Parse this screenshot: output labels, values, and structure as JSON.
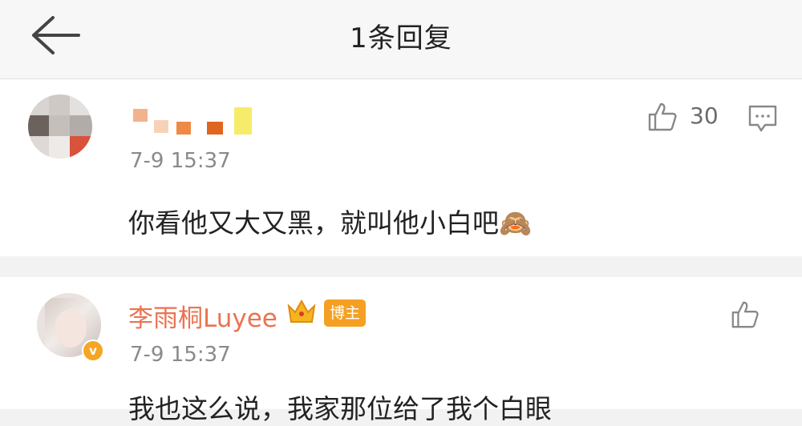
{
  "header": {
    "title": "1条回复",
    "back_icon": "arrow-left-icon"
  },
  "comment": {
    "timestamp": "7-9 15:37",
    "likes": "30",
    "text": "你看他又大又黑，就叫他小白吧",
    "emoji": "🙈",
    "icons": {
      "like": "thumbs-up-icon",
      "reply": "comment-icon"
    }
  },
  "reply": {
    "username": "李雨桐Luyee",
    "role_badge": "博主",
    "verified_mark": "v",
    "timestamp": "7-9 15:37",
    "text": "我也这么说，我家那位给了我个白眼",
    "icons": {
      "like": "thumbs-up-icon",
      "crown": "crown-icon"
    }
  },
  "colors": {
    "username": "#eb7350",
    "badge": "#f5a023",
    "background": "#f2f2f2"
  }
}
